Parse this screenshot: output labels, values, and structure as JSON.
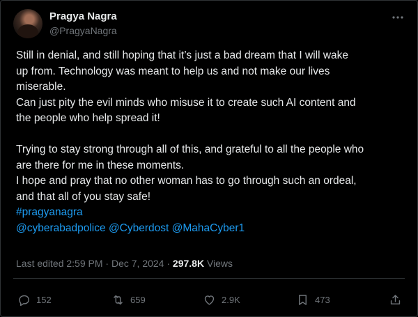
{
  "header": {
    "name": "Pragya Nagra",
    "handle": "@PragyaNagra",
    "more_icon": "more-icon"
  },
  "post": {
    "line1": "Still in denial, and still hoping that it’s just a bad dream that I will wake",
    "line2": "up from. Technology was meant to help us and not make our lives",
    "line3": "miserable.",
    "line4": "Can just pity the evil minds who misuse it to create such AI content and",
    "line5": "the people who help spread it!",
    "line6": "Trying to stay strong through all of this, and grateful to all the people who",
    "line7": "are there for me in these moments.",
    "line8": "I hope and pray that no other woman has to go through such an ordeal,",
    "line9": "and that all of you stay safe!",
    "hashtag": "#pragyanagra",
    "mentions": [
      "@cyberabadpolice",
      "@Cyberdost",
      "@MahaCyber1"
    ]
  },
  "meta": {
    "edited": "Last edited 2:59 PM · Dec 7, 2024 ·",
    "views_count": "297.8K",
    "views_label": "Views"
  },
  "actions": {
    "replies": "152",
    "reposts": "659",
    "likes": "2.9K",
    "bookmarks": "473"
  },
  "colors": {
    "background": "#000000",
    "text": "#e7e9ea",
    "secondary": "#71767b",
    "link": "#1d9bf0",
    "divider": "#2f3336"
  }
}
